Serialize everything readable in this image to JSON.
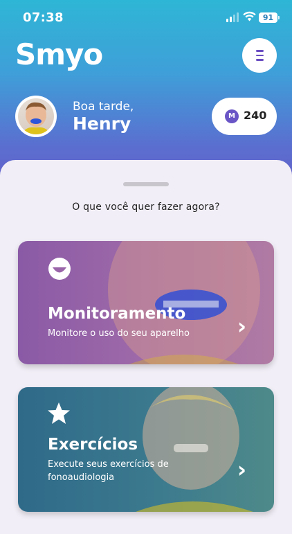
{
  "status_bar": {
    "time": "07:38",
    "battery": "91"
  },
  "header": {
    "logo": "Smyo"
  },
  "profile": {
    "greeting": "Boa tarde,",
    "name": "Henry",
    "points": "240"
  },
  "sheet": {
    "prompt": "O que você quer fazer agora?",
    "cards": [
      {
        "title": "Monitoramento",
        "subtitle": "Monitore o uso do seu aparelho",
        "icon": "smile-icon"
      },
      {
        "title": "Exercícios",
        "subtitle": "Execute seus exercícios de fonoaudiologia",
        "icon": "star-icon"
      }
    ]
  },
  "colors": {
    "primary": "#6b4fc2",
    "top_gradient": "#2eb6d6",
    "card1": "#9a65a9",
    "card2": "#356f8c"
  }
}
